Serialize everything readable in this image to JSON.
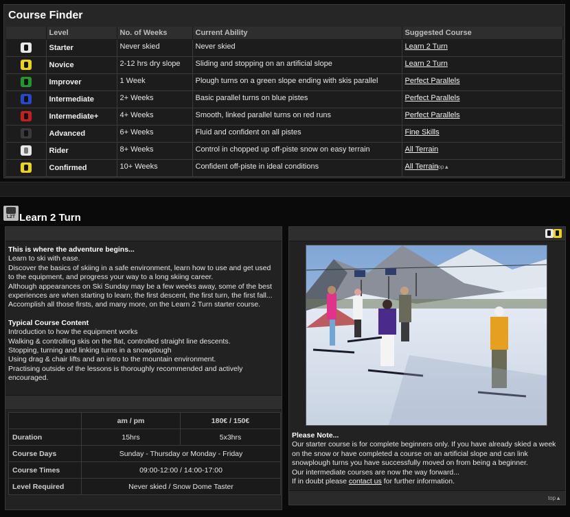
{
  "finder": {
    "title": "Course Finder",
    "headers": [
      "Level",
      "No. of Weeks",
      "Current Ability",
      "Suggested Course"
    ],
    "rows": [
      {
        "icon": "white-boot-icon",
        "level": "Starter",
        "weeks": "Never skied",
        "ability": "Never skied",
        "course": "Learn 2 Turn"
      },
      {
        "icon": "yellow-boot-icon",
        "level": "Novice",
        "weeks": "2-12 hrs dry slope",
        "ability": "Sliding and stopping on an artificial slope",
        "course": "Learn 2 Turn"
      },
      {
        "icon": "green-boot-icon",
        "level": "Improver",
        "weeks": "1 Week",
        "ability": "Plough turns on a green slope ending with skis parallel",
        "course": "Perfect Parallels"
      },
      {
        "icon": "blue-boot-icon",
        "level": "Intermediate",
        "weeks": "2+ Weeks",
        "ability": "Basic parallel turns on blue pistes",
        "course": "Perfect Parallels"
      },
      {
        "icon": "red-boot-icon",
        "level": "Intermediate+",
        "weeks": "4+ Weeks",
        "ability": "Smooth, linked parallel turns on red runs",
        "course": "Perfect Parallels"
      },
      {
        "icon": "black-boot-icon",
        "level": "Advanced",
        "weeks": "6+  Weeks",
        "ability": "Fluid and confident on all pistes",
        "course": "Fine Skills"
      },
      {
        "icon": "grey-boot-icon",
        "level": "Rider",
        "weeks": "8+  Weeks",
        "ability": "Control in chopped up off-piste snow on easy terrain",
        "course": "All Terrain"
      },
      {
        "icon": "gold-boot-icon",
        "level": "Confirmed",
        "weeks": "10+  Weeks",
        "ability": "Confident off-piste in ideal conditions",
        "course": "All Terrain"
      }
    ],
    "top_label": "top▲"
  },
  "course": {
    "badge": "L2T",
    "title": "Learn 2 Turn",
    "intro_heading": "This is where the adventure begins...",
    "intro_lines": [
      "Learn to ski with ease.",
      "Discover the basics of skiing in a safe environment, learn how to use and get used to the equipment, and progress your way to a long skiing career.",
      "Although appearances on Ski Sunday may be a few weeks away, some of the best experiences are when starting to learn; the first descent, the first turn, the first fall...",
      "Accomplish all those firsts, and many more, on the Learn 2 Turn starter course."
    ],
    "content_heading": "Typical Course Content",
    "content_lines": [
      "Introduction to how the equipment works",
      "Walking & controlling skis on the flat, controlled straight line descents.",
      "Stopping, turning and linking turns in a snowplough",
      "Using drag & chair lifts and an intro to the mountain environment.",
      "Practising outside of the lessons is thoroughly recommended and actively encouraged."
    ],
    "price_table": {
      "col1": "am / pm",
      "col2": "180€ / 150€",
      "rows": [
        {
          "label": "Duration",
          "c1": "15hrs",
          "c2": "5x3hrs"
        },
        {
          "label": "Course Days",
          "span": "Sunday - Thursday or Monday - Friday"
        },
        {
          "label": "Course Times",
          "span": "09:00-12:00  /  14:00-17:00"
        },
        {
          "label": "Level Required",
          "span": "Never skied / Snow Dome Taster"
        }
      ]
    },
    "note_heading": "Please Note...",
    "note_lines": [
      "Our starter course is for complete beginners only. If you have already skied a week on the snow or have completed a course on an artificial slope and can link snowplough turns you have successfully moved on from being a beginner.",
      "Our intermediate courses are now the way forward..."
    ],
    "note_contact_prefix": "If in doubt please ",
    "note_contact_link": "contact us",
    "note_contact_suffix": " for further information.",
    "top_label": "top▲"
  },
  "colors": {
    "white": "#e8e8e8",
    "yellow": "#ecd414",
    "green": "#1f9a2a",
    "blue": "#2549c8",
    "red": "#c81e1e",
    "black": "#3a3a3a"
  }
}
